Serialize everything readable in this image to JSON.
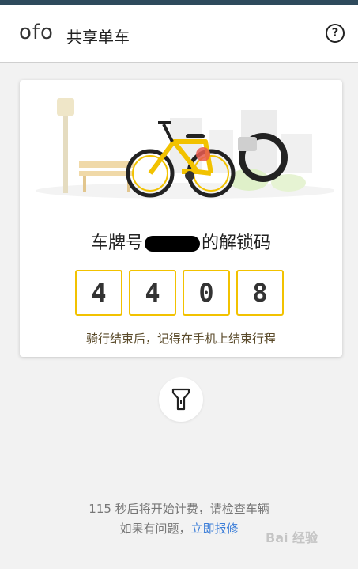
{
  "header": {
    "logo_text": "ofo",
    "title": "共享单车",
    "help_icon": "question-circle-icon",
    "help_glyph": "?"
  },
  "card": {
    "illustration_icon": "bicycle-illustration",
    "plate_prefix": "车牌号",
    "plate_suffix": "的解锁码",
    "unlock_digits": [
      "4",
      "4",
      "0",
      "8"
    ],
    "hint": "骑行结束后，记得在手机上结束行程"
  },
  "flashlight": {
    "icon": "flashlight-icon"
  },
  "footer": {
    "countdown_text": "115 秒后将开始计费，请检查车辆",
    "problem_text": "如果有问题，",
    "report_link": "立即报修"
  },
  "watermark": {
    "text": "Bai 经验"
  },
  "colors": {
    "accent": "#f2c200",
    "link": "#3b7dd8",
    "topbar": "#2e4a5c"
  }
}
